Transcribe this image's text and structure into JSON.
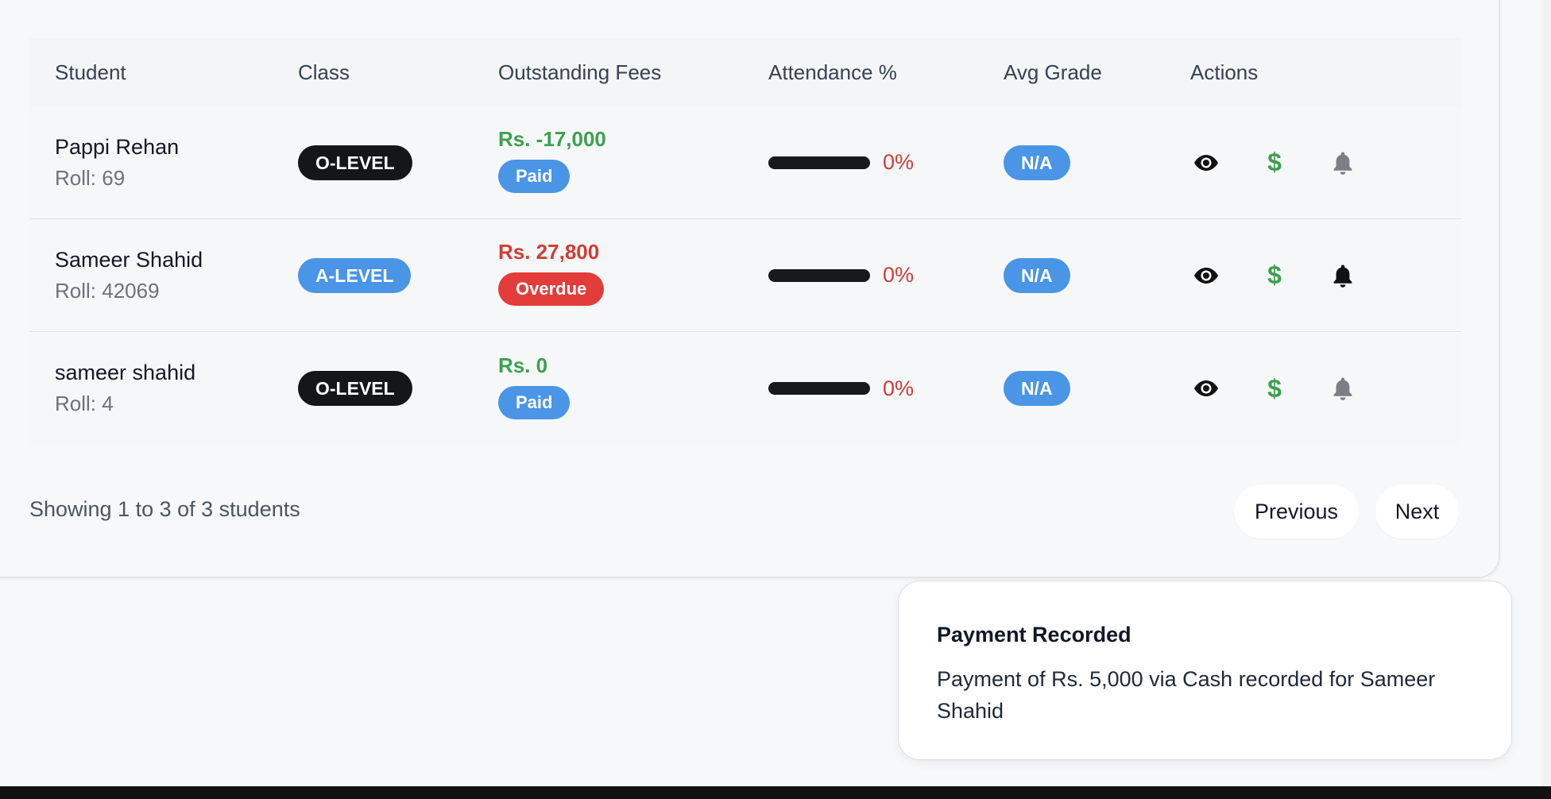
{
  "table": {
    "headers": {
      "student": "Student",
      "class": "Class",
      "fees": "Outstanding Fees",
      "attendance": "Attendance %",
      "grade": "Avg Grade",
      "actions": "Actions"
    },
    "rows": [
      {
        "name": "Pappi Rehan",
        "roll": "Roll: 69",
        "class": "O-LEVEL",
        "class_style": "dark",
        "fee": "Rs. -17,000",
        "fee_color": "#3ea050",
        "status": "Paid",
        "status_color": "#4a95e6",
        "attendance_fill": 0,
        "attendance": "0%",
        "grade": "N/A",
        "notify_active": false
      },
      {
        "name": "Sameer Shahid",
        "roll": "Roll: 42069",
        "class": "A-LEVEL",
        "class_style": "blue",
        "fee": "Rs. 27,800",
        "fee_color": "#d23c36",
        "status": "Overdue",
        "status_color": "#e23d3b",
        "attendance_fill": 0,
        "attendance": "0%",
        "grade": "N/A",
        "notify_active": true
      },
      {
        "name": "sameer shahid",
        "roll": "Roll: 4",
        "class": "O-LEVEL",
        "class_style": "dark",
        "fee": "Rs. 0",
        "fee_color": "#3ea050",
        "status": "Paid",
        "status_color": "#4a95e6",
        "attendance_fill": 0,
        "attendance": "0%",
        "grade": "N/A",
        "notify_active": false
      }
    ]
  },
  "pagination": {
    "summary": "Showing 1 to 3 of 3 students",
    "previous_label": "Previous",
    "next_label": "Next"
  },
  "toast": {
    "title": "Payment Recorded",
    "message": "Payment of Rs. 5,000 via Cash recorded for Sameer Shahid"
  },
  "icons": {
    "view": "eye-icon",
    "pay": "dollar-icon",
    "notify": "bell-icon",
    "dollar_glyph": "$"
  },
  "colors": {
    "accent_blue": "#4a95e6",
    "success_green": "#3ea050",
    "danger_red": "#d23c36",
    "bell_inactive": "#7b7f85",
    "bell_active": "#111111"
  }
}
